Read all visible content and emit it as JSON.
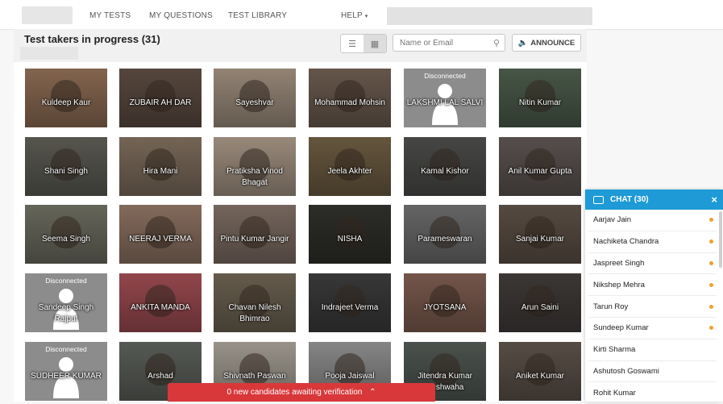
{
  "nav": {
    "items": [
      "MY TESTS",
      "MY QUESTIONS",
      "TEST LIBRARY",
      "HELP"
    ]
  },
  "header": {
    "title": "Test takers in progress (31)",
    "search_placeholder": "Name or Email",
    "announce_label": "ANNOUNCE"
  },
  "tiles": [
    {
      "name": "Kuldeep Kaur",
      "status": ""
    },
    {
      "name": "ZUBAIR AH DAR",
      "status": ""
    },
    {
      "name": "Sayeshvar",
      "status": ""
    },
    {
      "name": "Mohammad Mohsin",
      "status": ""
    },
    {
      "name": "LAKSHMI LAL SALVI",
      "status": "Disconnected"
    },
    {
      "name": "Nitin Kumar",
      "status": ""
    },
    {
      "name": "Shani Singh",
      "status": ""
    },
    {
      "name": "Hira Mani",
      "status": ""
    },
    {
      "name": "Pratiksha Vinod Bhagat",
      "status": ""
    },
    {
      "name": "Jeela Akhter",
      "status": ""
    },
    {
      "name": "Kamal Kishor",
      "status": ""
    },
    {
      "name": "Anil Kumar Gupta",
      "status": ""
    },
    {
      "name": "Seema Singh",
      "status": ""
    },
    {
      "name": "NEERAJ VERMA",
      "status": ""
    },
    {
      "name": "Pintu Kumar Jangir",
      "status": ""
    },
    {
      "name": "NISHA",
      "status": ""
    },
    {
      "name": "Parameswaran",
      "status": ""
    },
    {
      "name": "Sanjai Kumar",
      "status": ""
    },
    {
      "name": "Sandeep Singh Rajput",
      "status": "Disconnected"
    },
    {
      "name": "ANKITA MANDA",
      "status": ""
    },
    {
      "name": "Chavan Nilesh Bhimrao",
      "status": ""
    },
    {
      "name": "Indrajeet Verma",
      "status": ""
    },
    {
      "name": "JYOTSANA",
      "status": ""
    },
    {
      "name": "Arun Saini",
      "status": ""
    },
    {
      "name": "SUDHEER KUMAR",
      "status": "Disconnected"
    },
    {
      "name": "Arshad",
      "status": ""
    },
    {
      "name": "Shivnath Paswan",
      "status": ""
    },
    {
      "name": "Pooja Jaiswal",
      "status": ""
    },
    {
      "name": "Jitendra Kumar Kushwaha",
      "status": ""
    },
    {
      "name": "Aniket Kumar",
      "status": ""
    }
  ],
  "tile_colors": [
    "#8a6a52",
    "#5a4a40",
    "#9a8a7a",
    "#6a5a4e",
    "#8c8c8c",
    "#4a5a4a",
    "#5a5a52",
    "#7a6a5a",
    "#a09080",
    "#6a5a40",
    "#4a4a48",
    "#5a5250",
    "#6a6a5e",
    "#8a7060",
    "#7a6a60",
    "#2e2e2a",
    "#6a6a6a",
    "#5a4e44",
    "#8c8c8c",
    "#9a4a50",
    "#6a6050",
    "#3a3a3a",
    "#7a5a4e",
    "#3e3a38",
    "#8c8c8c",
    "#5a5e58",
    "#a09a90",
    "#8c8c8c",
    "#4e5650",
    "#5a5048"
  ],
  "chat": {
    "title": "CHAT (30)",
    "items": [
      {
        "name": "Aarjav Jain",
        "unread": true
      },
      {
        "name": "Nachiketa Chandra",
        "unread": true
      },
      {
        "name": "Jaspreet Singh",
        "unread": true
      },
      {
        "name": "Nikshep Mehra",
        "unread": true
      },
      {
        "name": "Tarun Roy",
        "unread": true
      },
      {
        "name": "Sundeep Kumar",
        "unread": true
      },
      {
        "name": "Kirti Sharma",
        "unread": false
      },
      {
        "name": "Ashutosh Goswami",
        "unread": false
      },
      {
        "name": "Rohit Kumar",
        "unread": false
      }
    ]
  },
  "banner": {
    "text": "0 new candidates awaiting verification"
  }
}
